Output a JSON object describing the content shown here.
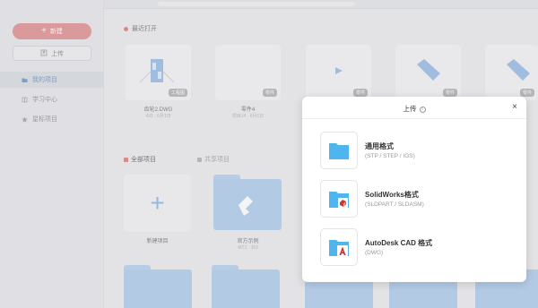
{
  "sidebar": {
    "new_label": "新建",
    "upload_label": "上传",
    "items": [
      {
        "label": "我的项目"
      },
      {
        "label": "学习中心"
      },
      {
        "label": "星标项目"
      }
    ]
  },
  "recent": {
    "title": "最近打开",
    "cards": [
      {
        "name": "齿轮2.DWG",
        "meta": "433 · 6月1日",
        "badge": "工程图"
      },
      {
        "name": "零件4",
        "meta": "项目14 · 6月1日",
        "badge": "零件"
      },
      {
        "name": "",
        "meta": "",
        "badge": "零件"
      },
      {
        "name": "",
        "meta": "",
        "badge": "零件"
      },
      {
        "name": "",
        "meta": "",
        "badge": "零件"
      }
    ]
  },
  "projects": {
    "tab_all": "全部项目",
    "tab_shared": "共享项目",
    "new_project_label": "新建项目",
    "folder1_name": "官方示例",
    "folder1_meta": "MT1 · 共3"
  },
  "modal": {
    "title": "上传",
    "close": "×",
    "options": [
      {
        "title": "通用格式",
        "sub": "(STP / STEP / IGS)"
      },
      {
        "title": "SolidWorks格式",
        "sub": "(SLDPART / SLDASM)"
      },
      {
        "title": "AutoDesk CAD 格式",
        "sub": "(DWG)"
      }
    ]
  },
  "colors": {
    "accent_red": "#dc8787",
    "folder_blue": "#a9c7ea",
    "icon_blue": "#4fb5ee",
    "sw_red": "#d33434",
    "cad_red": "#c62828"
  }
}
